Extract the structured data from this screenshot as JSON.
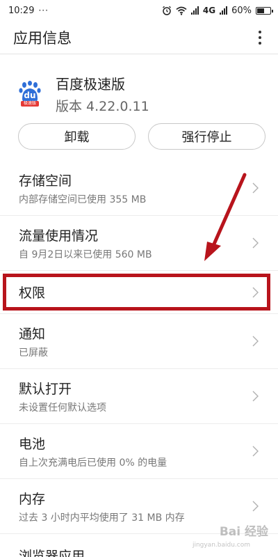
{
  "status_bar": {
    "time": "10:29",
    "dots": "···",
    "network": "4G",
    "battery_percent": "60%",
    "battery_level": 0.6,
    "icons": [
      "alarm-icon",
      "wifi-icon",
      "signal-icon",
      "signal-icon",
      "battery-icon"
    ]
  },
  "header": {
    "title": "应用信息",
    "more_icon": "more-vert-icon"
  },
  "app": {
    "name": "百度极速版",
    "version": "版本 4.22.0.11",
    "icon": "baidu-app-icon",
    "icon_text": "du",
    "icon_badge": "极速版",
    "icon_color": "#2f6fd8",
    "badge_color": "#e53935"
  },
  "buttons": {
    "uninstall": "卸载",
    "force_stop": "强行停止"
  },
  "items": [
    {
      "title": "存储空间",
      "subtitle": "内部存储空间已使用 355 MB"
    },
    {
      "title": "流量使用情况",
      "subtitle": "自 9月2日以来已使用 560 MB"
    },
    {
      "title": "权限",
      "subtitle": ""
    },
    {
      "title": "通知",
      "subtitle": "已屏蔽"
    },
    {
      "title": "默认打开",
      "subtitle": "未设置任何默认选项"
    },
    {
      "title": "电池",
      "subtitle": "自上次充满电后已使用 0% 的电量"
    },
    {
      "title": "内存",
      "subtitle": "过去 3 小时内平均使用了 31 MB 内存"
    },
    {
      "title": "浏览器应用",
      "subtitle": ""
    }
  ],
  "annotation": {
    "highlight_color": "#b8141c"
  },
  "watermark": {
    "text": "Bai  经验",
    "sub": "jingyan.baidu.com"
  }
}
